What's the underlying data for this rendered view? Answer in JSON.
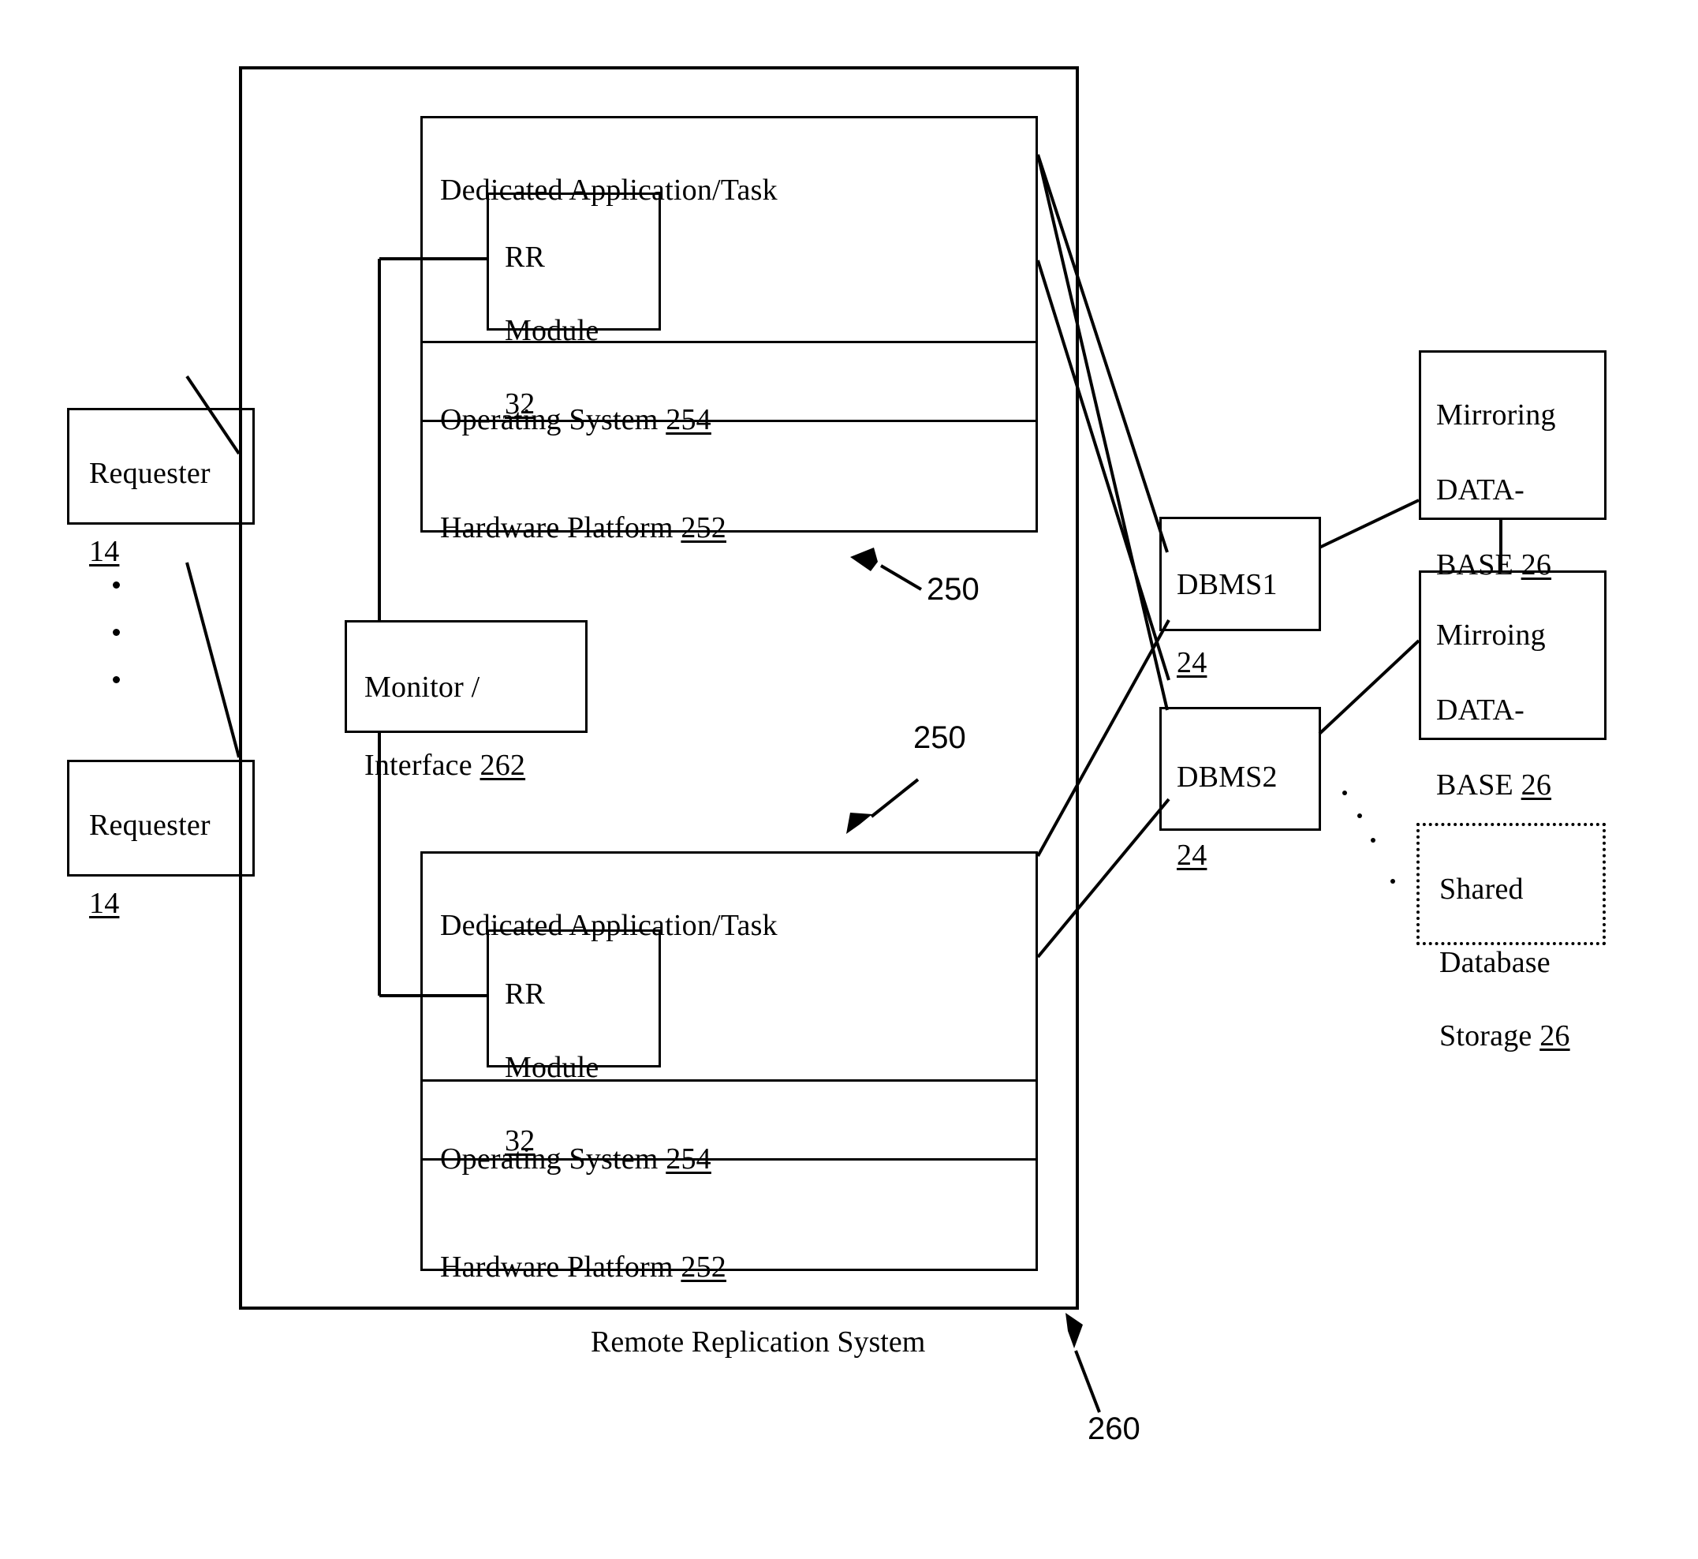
{
  "figure": {
    "caption": "Remote Replication System",
    "caption_ref": "260"
  },
  "requesters": [
    {
      "name": "Requester",
      "ref": "14"
    },
    {
      "name": "Requester",
      "ref": "14"
    }
  ],
  "monitor": {
    "line1": "Monitor /",
    "line2": "Interface ",
    "ref": "262"
  },
  "platforms": [
    {
      "ref": "250",
      "application": {
        "label": "Dedicated Application/Task"
      },
      "rr_module": {
        "line1": "RR",
        "line2": "Module",
        "ref": "32"
      },
      "operating_system": {
        "label": "Operating System ",
        "ref": "254"
      },
      "hardware_platform": {
        "label": "Hardware Platform ",
        "ref": "252"
      }
    },
    {
      "ref": "250",
      "application": {
        "label": "Dedicated Application/Task"
      },
      "rr_module": {
        "line1": "RR",
        "line2": "Module",
        "ref": "32"
      },
      "operating_system": {
        "label": "Operating System ",
        "ref": "254"
      },
      "hardware_platform": {
        "label": "Hardware Platform ",
        "ref": "252"
      }
    }
  ],
  "dbms": [
    {
      "name": "DBMS1",
      "ref": "24"
    },
    {
      "name": "DBMS2",
      "ref": "24"
    }
  ],
  "databases": [
    {
      "line1": "Mirroring",
      "line2": "DATA-",
      "line3": "BASE ",
      "ref": "26"
    },
    {
      "line1": "Mirroing",
      "line2": "DATA-",
      "line3": "BASE ",
      "ref": "26"
    }
  ],
  "shared_storage": {
    "line1": "Shared",
    "line2": "Database",
    "line3": "Storage ",
    "ref": "26"
  },
  "colors": {
    "stroke": "#000000",
    "background": "#ffffff"
  }
}
